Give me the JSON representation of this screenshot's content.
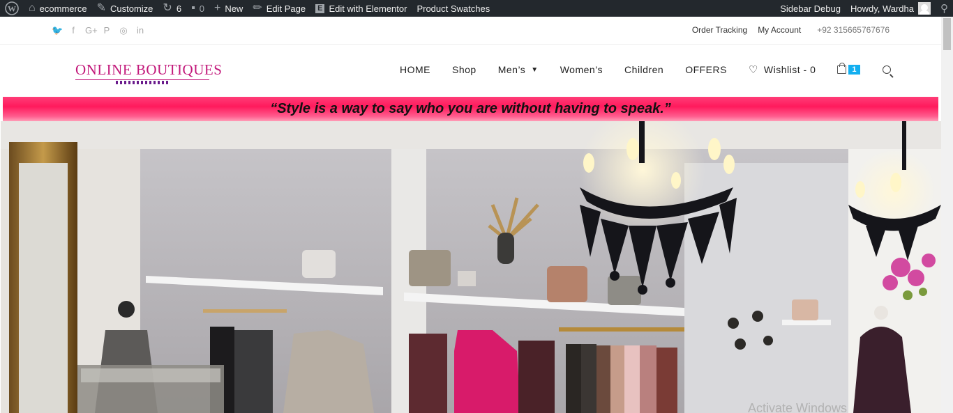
{
  "adminbar": {
    "wp_icon": "wordpress-logo-icon",
    "site_name": "ecommerce",
    "customize": "Customize",
    "updates_count": "6",
    "comments_count": "0",
    "new_label": "New",
    "edit_page": "Edit Page",
    "elementor_badge": "E",
    "edit_elementor": "Edit with Elementor",
    "product_swatches": "Product Swatches",
    "sidebar_debug": "Sidebar Debug",
    "howdy": "Howdy, Wardha"
  },
  "topbar": {
    "social_icons": [
      "twitter-icon",
      "facebook-icon",
      "google-plus-icon",
      "pinterest-icon",
      "instagram-icon",
      "linkedin-icon"
    ],
    "social_glyphs": [
      "🐦",
      "f",
      "G+",
      "P",
      "◎",
      "in"
    ],
    "order_tracking": "Order Tracking",
    "my_account": "My Account",
    "phone": "+92 315665767676"
  },
  "header": {
    "logo_text": "ONLINE BOUTIQUES",
    "nav": {
      "home": "HOME",
      "shop": "Shop",
      "mens": "Men’s",
      "womens": "Women’s",
      "children": "Children",
      "offers": "OFFERS",
      "wishlist": "Wishlist - 0",
      "cart_count": "1"
    }
  },
  "banner": {
    "quote": "“Style is a way to say who you are without having to speak.”"
  },
  "watermark": "Activate Windows",
  "colors": {
    "brand": "#c2187a",
    "banner": "#ff1a5c",
    "accent": "#13aff0",
    "adminbar": "#23282d"
  }
}
